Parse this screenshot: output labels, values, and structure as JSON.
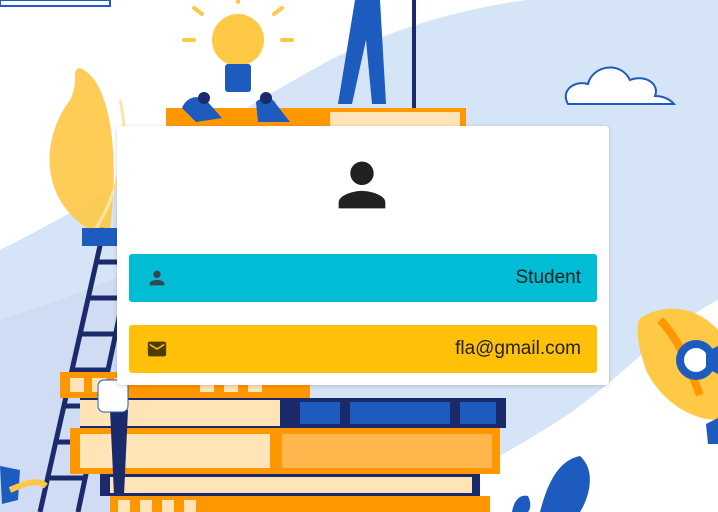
{
  "profile": {
    "avatar_icon": "person-icon",
    "role": {
      "icon": "person-icon",
      "value": "Student"
    },
    "email": {
      "icon": "mail-icon",
      "value": "fla@gmail.com"
    }
  },
  "colors": {
    "role_field": "#00bcd4",
    "email_field": "#ffc107",
    "background_blue": "#d6e4f7",
    "accent_blue": "#1e5bbf",
    "accent_orange": "#ff9800",
    "accent_yellow": "#ffc845"
  }
}
